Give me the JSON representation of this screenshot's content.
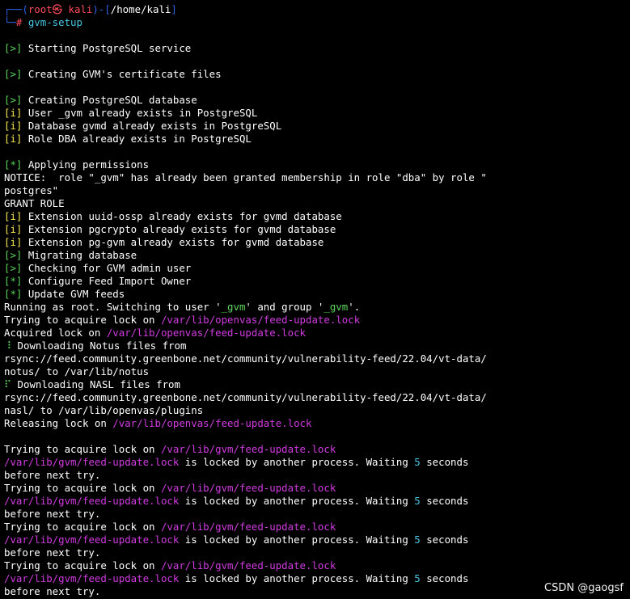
{
  "prompt": {
    "user": "root",
    "host": "kali",
    "at_symbol": "㉿",
    "cwd": "/home/kali",
    "hash": "#",
    "command": "gvm-setup"
  },
  "colors": {
    "background": "#000000",
    "text": "#ffffff",
    "green": "#5cd65c",
    "yellow": "#f2e94e",
    "red": "#ff4b5c",
    "blue": "#2f63e8",
    "magenta": "#d13be0",
    "cyan": "#47c7df"
  },
  "output": [
    {
      "segments": [
        {
          "text": "┌──(",
          "color": "blue"
        },
        {
          "text": "root㉿ kali",
          "color": "red"
        },
        {
          "text": ")-[",
          "color": "blue"
        },
        {
          "text": "/home/kali",
          "color": "white"
        },
        {
          "text": "]",
          "color": "blue"
        }
      ]
    },
    {
      "segments": [
        {
          "text": "└─",
          "color": "blue"
        },
        {
          "text": "# ",
          "color": "red"
        },
        {
          "text": "gvm-setup",
          "color": "cyan"
        }
      ]
    },
    {
      "segments": []
    },
    {
      "segments": [
        {
          "text": "[>]",
          "color": "green"
        },
        {
          "text": " Starting PostgreSQL service",
          "color": "white"
        }
      ]
    },
    {
      "segments": []
    },
    {
      "segments": [
        {
          "text": "[>]",
          "color": "green"
        },
        {
          "text": " Creating GVM's certificate files",
          "color": "white"
        }
      ]
    },
    {
      "segments": []
    },
    {
      "segments": [
        {
          "text": "[>]",
          "color": "green"
        },
        {
          "text": " Creating PostgreSQL database",
          "color": "white"
        }
      ]
    },
    {
      "segments": [
        {
          "text": "[i]",
          "color": "yellow"
        },
        {
          "text": " User _gvm already exists in PostgreSQL",
          "color": "white"
        }
      ]
    },
    {
      "segments": [
        {
          "text": "[i]",
          "color": "yellow"
        },
        {
          "text": " Database gvmd already exists in PostgreSQL",
          "color": "white"
        }
      ]
    },
    {
      "segments": [
        {
          "text": "[i]",
          "color": "yellow"
        },
        {
          "text": " Role DBA already exists in PostgreSQL",
          "color": "white"
        }
      ]
    },
    {
      "segments": []
    },
    {
      "segments": [
        {
          "text": "[*]",
          "color": "green"
        },
        {
          "text": " Applying permissions",
          "color": "white"
        }
      ]
    },
    {
      "segments": [
        {
          "text": "NOTICE:  role \"_gvm\" has already been granted membership in role \"dba\" by role \"",
          "color": "white"
        }
      ]
    },
    {
      "segments": [
        {
          "text": "postgres\"",
          "color": "white"
        }
      ]
    },
    {
      "segments": [
        {
          "text": "GRANT ROLE",
          "color": "white"
        }
      ]
    },
    {
      "segments": [
        {
          "text": "[i]",
          "color": "yellow"
        },
        {
          "text": " Extension uuid-ossp already exists for gvmd database",
          "color": "white"
        }
      ]
    },
    {
      "segments": [
        {
          "text": "[i]",
          "color": "yellow"
        },
        {
          "text": " Extension pgcrypto already exists for gvmd database",
          "color": "white"
        }
      ]
    },
    {
      "segments": [
        {
          "text": "[i]",
          "color": "yellow"
        },
        {
          "text": " Extension pg-gvm already exists for gvmd database",
          "color": "white"
        }
      ]
    },
    {
      "segments": [
        {
          "text": "[>]",
          "color": "green"
        },
        {
          "text": " Migrating database",
          "color": "white"
        }
      ]
    },
    {
      "segments": [
        {
          "text": "[>]",
          "color": "green"
        },
        {
          "text": " Checking for GVM admin user",
          "color": "white"
        }
      ]
    },
    {
      "segments": [
        {
          "text": "[*]",
          "color": "green"
        },
        {
          "text": " Configure Feed Import Owner",
          "color": "white"
        }
      ]
    },
    {
      "segments": [
        {
          "text": "[*]",
          "color": "green"
        },
        {
          "text": " Update GVM feeds",
          "color": "white"
        }
      ]
    },
    {
      "segments": [
        {
          "text": "Running as root. Switching to user '",
          "color": "white"
        },
        {
          "text": "_gvm",
          "color": "green"
        },
        {
          "text": "' and group '",
          "color": "white"
        },
        {
          "text": "_gvm",
          "color": "green"
        },
        {
          "text": "'.",
          "color": "white"
        }
      ]
    },
    {
      "segments": [
        {
          "text": "Trying to acquire lock on ",
          "color": "white"
        },
        {
          "text": "/var/lib/openvas/",
          "color": "magenta"
        },
        {
          "text": "feed-update.lock",
          "color": "magenta"
        }
      ]
    },
    {
      "segments": [
        {
          "text": "Acquired lock on ",
          "color": "white"
        },
        {
          "text": "/var/lib/openvas/",
          "color": "magenta"
        },
        {
          "text": "feed-update.lock",
          "color": "magenta"
        }
      ]
    },
    {
      "segments": [
        {
          "text": "⠸",
          "color": "green"
        },
        {
          "text": " Downloading Notus files from",
          "color": "white"
        }
      ]
    },
    {
      "segments": [
        {
          "text": "rsync://feed.community.greenbone.net/community/vulnerability-feed/22.04/vt-data/",
          "color": "white"
        }
      ]
    },
    {
      "segments": [
        {
          "text": "notus/ to /var/lib/notus",
          "color": "white"
        }
      ]
    },
    {
      "segments": [
        {
          "text": "⠏",
          "color": "green"
        },
        {
          "text": " Downloading NASL files from",
          "color": "white"
        }
      ]
    },
    {
      "segments": [
        {
          "text": "rsync://feed.community.greenbone.net/community/vulnerability-feed/22.04/vt-data/",
          "color": "white"
        }
      ]
    },
    {
      "segments": [
        {
          "text": "nasl/ to /var/lib/openvas/plugins",
          "color": "white"
        }
      ]
    },
    {
      "segments": [
        {
          "text": "Releasing lock on ",
          "color": "white"
        },
        {
          "text": "/var/lib/openvas/",
          "color": "magenta"
        },
        {
          "text": "feed-update.lock",
          "color": "magenta"
        }
      ]
    },
    {
      "segments": []
    },
    {
      "segments": [
        {
          "text": "Trying to acquire lock on ",
          "color": "white"
        },
        {
          "text": "/var/lib/gvm/",
          "color": "magenta"
        },
        {
          "text": "feed-update.lock",
          "color": "magenta"
        }
      ]
    },
    {
      "segments": [
        {
          "text": "/var/lib/gvm/",
          "color": "magenta"
        },
        {
          "text": "feed-update.lock",
          "color": "magenta"
        },
        {
          "text": " is locked by another process. Waiting ",
          "color": "white"
        },
        {
          "text": "5",
          "color": "cyan"
        },
        {
          "text": " seconds",
          "color": "white"
        }
      ]
    },
    {
      "segments": [
        {
          "text": "before next try.",
          "color": "white"
        }
      ]
    },
    {
      "segments": [
        {
          "text": "Trying to acquire lock on ",
          "color": "white"
        },
        {
          "text": "/var/lib/gvm/",
          "color": "magenta"
        },
        {
          "text": "feed-update.lock",
          "color": "magenta"
        }
      ]
    },
    {
      "segments": [
        {
          "text": "/var/lib/gvm/",
          "color": "magenta"
        },
        {
          "text": "feed-update.lock",
          "color": "magenta"
        },
        {
          "text": " is locked by another process. Waiting ",
          "color": "white"
        },
        {
          "text": "5",
          "color": "cyan"
        },
        {
          "text": " seconds",
          "color": "white"
        }
      ]
    },
    {
      "segments": [
        {
          "text": "before next try.",
          "color": "white"
        }
      ]
    },
    {
      "segments": [
        {
          "text": "Trying to acquire lock on ",
          "color": "white"
        },
        {
          "text": "/var/lib/gvm/",
          "color": "magenta"
        },
        {
          "text": "feed-update.lock",
          "color": "magenta"
        }
      ]
    },
    {
      "segments": [
        {
          "text": "/var/lib/gvm/",
          "color": "magenta"
        },
        {
          "text": "feed-update.lock",
          "color": "magenta"
        },
        {
          "text": " is locked by another process. Waiting ",
          "color": "white"
        },
        {
          "text": "5",
          "color": "cyan"
        },
        {
          "text": " seconds",
          "color": "white"
        }
      ]
    },
    {
      "segments": [
        {
          "text": "before next try.",
          "color": "white"
        }
      ]
    },
    {
      "segments": [
        {
          "text": "Trying to acquire lock on ",
          "color": "white"
        },
        {
          "text": "/var/lib/gvm/",
          "color": "magenta"
        },
        {
          "text": "feed-update.lock",
          "color": "magenta"
        }
      ]
    },
    {
      "segments": [
        {
          "text": "/var/lib/gvm/",
          "color": "magenta"
        },
        {
          "text": "feed-update.lock",
          "color": "magenta"
        },
        {
          "text": " is locked by another process. Waiting ",
          "color": "white"
        },
        {
          "text": "5",
          "color": "cyan"
        },
        {
          "text": " seconds",
          "color": "white"
        }
      ]
    },
    {
      "segments": [
        {
          "text": "before next try.",
          "color": "white"
        }
      ]
    }
  ],
  "watermark": "CSDN @gaogsf"
}
